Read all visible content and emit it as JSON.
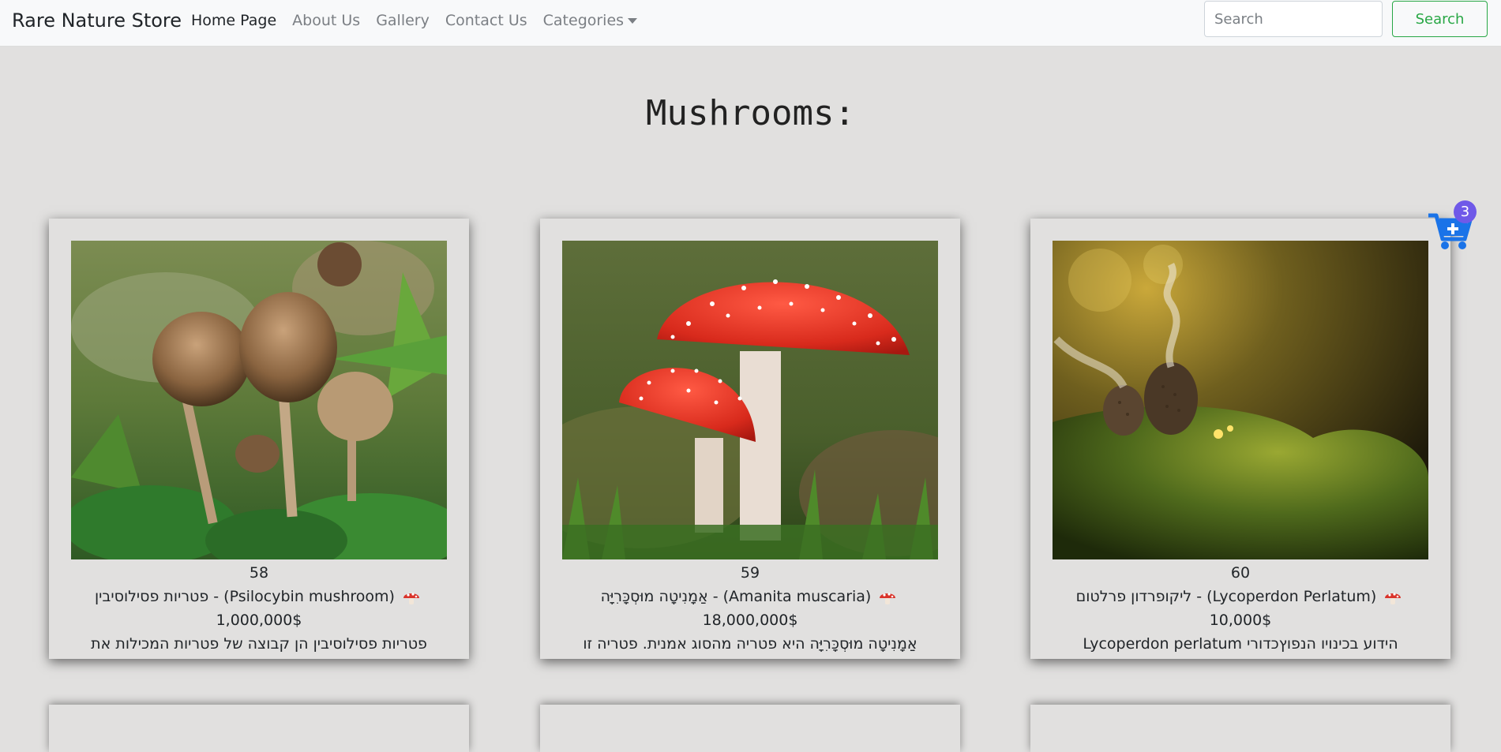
{
  "navbar": {
    "brand": "Rare Nature Store",
    "links": [
      "Home Page",
      "About Us",
      "Gallery",
      "Contact Us"
    ],
    "categories_label": "Categories",
    "search_placeholder": "Search",
    "search_button": "Search"
  },
  "page": {
    "title": "Mushrooms:"
  },
  "cart": {
    "count": "3"
  },
  "products": [
    {
      "id": "58",
      "name": "פטריות פסילוסיבין - (Psilocybin mushroom)",
      "price": "1,000,000$",
      "description": "פטריות פסילוסיבין הן קבוצה של פטריות המכילות את"
    },
    {
      "id": "59",
      "name": "אַמָנִיטָה מוּסְכָּרִיָּה - (Amanita muscaria)",
      "price": "18,000,000$",
      "description": "אַמָנִיטָה מוּסְכָּרִיָּה היא פטריה מהסוג אמנית. פטריה זו"
    },
    {
      "id": "60",
      "name": "ליקופרדון פרלטום - (Lycoperdon Perlatum)",
      "price": "10,000$",
      "description": "Lycoperdon perlatum הידוע בכינויו הנפוץכדורי"
    }
  ],
  "colors": {
    "accent_green": "#28a745",
    "cart_blue": "#1a73e8",
    "badge_purple": "#6f59e8",
    "mushroom_red": "#d9342b"
  }
}
